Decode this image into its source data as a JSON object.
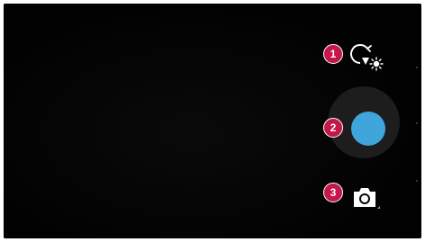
{
  "callouts": [
    {
      "number": "1",
      "target": "settings"
    },
    {
      "number": "2",
      "target": "capture"
    },
    {
      "number": "3",
      "target": "mode"
    }
  ],
  "icons": {
    "settings": "settings-icon",
    "shutter": "shutter-button",
    "mode": "camera-mode-icon"
  },
  "colors": {
    "background": "#050505",
    "shutter": "#3fa6dc",
    "callout": "#c5174a"
  }
}
